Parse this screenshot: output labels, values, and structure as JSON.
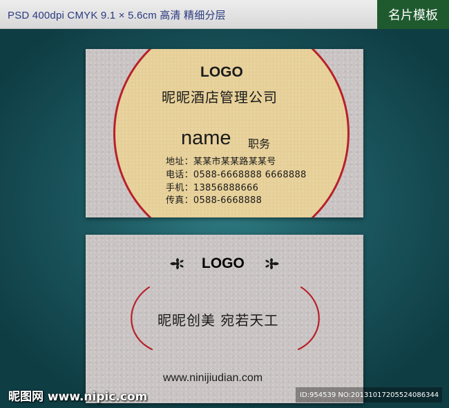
{
  "header": {
    "spec": "PSD 400dpi CMYK  9.1 × 5.6cm  高清 精细分层",
    "badge": "名片模板"
  },
  "front": {
    "logo": "LOGO",
    "company": "昵昵酒店管理公司",
    "name": "name",
    "position": "职务",
    "info": [
      "地址：某某市某某路某某号",
      "电话：0588-6668888 6668888",
      "手机：13856888666",
      "传真：0588-6668888"
    ]
  },
  "back": {
    "logo": "LOGO",
    "slogan": "昵昵创美  宛若天工",
    "website": "www.ninijiudian.com"
  },
  "watermark": {
    "site": "昵图网 www.nipic.com",
    "id": "ID:954539 NO:20131017205524086344"
  },
  "colors": {
    "accent_red": "#b8202a",
    "circle_gold": "#e6cf97",
    "card_gray": "#c9c4c3",
    "badge_green": "#1f5a2e",
    "background_teal": "#1d5a62"
  }
}
